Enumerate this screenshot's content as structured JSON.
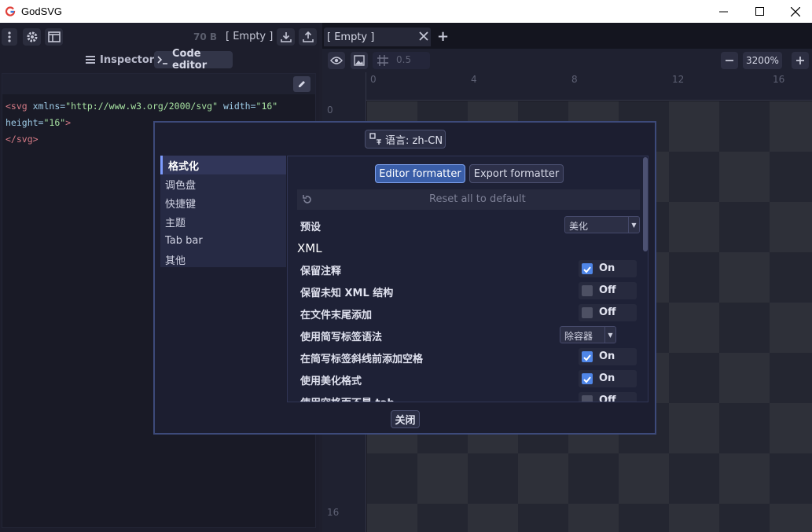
{
  "window": {
    "title": "GodSVG"
  },
  "left_panel": {
    "file_size": "70 B",
    "file_name": "[ Empty ]",
    "tabs": {
      "inspector": "Inspector",
      "code_editor": "Code editor"
    },
    "code_lines": [
      {
        "tag_open": "<svg",
        "attr1": " xmlns=",
        "str1": "\"http://www.w3.org/2000/svg\"",
        "attr2": " width=",
        "str2": "\"16\""
      },
      {
        "attr3": "height=",
        "str3": "\"16\"",
        "end": ">"
      },
      {
        "close": "</",
        "close_tag": "svg",
        "close_end": ">"
      }
    ]
  },
  "right_panel": {
    "tab_label": "[ Empty ]",
    "snap_value": "0.5",
    "zoom": "3200%",
    "ruler_top": [
      "0",
      "4",
      "8",
      "12",
      "16"
    ],
    "ruler_left": [
      "0",
      "16"
    ]
  },
  "dialog": {
    "language_button": "语言: zh-CN",
    "nav": [
      "格式化",
      "调色盘",
      "快捷键",
      "主题",
      "Tab bar",
      "其他"
    ],
    "segments": {
      "active": "Editor formatter",
      "inactive": "Export formatter"
    },
    "reset_label": "Reset all to default",
    "preset": {
      "label": "预设",
      "value": "美化"
    },
    "section": "XML",
    "settings": [
      {
        "label": "保留注释",
        "kind": "check",
        "state": "On"
      },
      {
        "label": "保留未知 XML 结构",
        "kind": "check",
        "state": "Off"
      },
      {
        "label": "在文件末尾添加",
        "kind": "check",
        "state": "Off"
      },
      {
        "label": "使用简写标签语法",
        "kind": "select",
        "value": "除容器"
      },
      {
        "label": "在简写标签斜线前添加空格",
        "kind": "check",
        "state": "On"
      },
      {
        "label": "使用美化格式",
        "kind": "check",
        "state": "On"
      },
      {
        "label": "使用空格而不是 tab",
        "kind": "check",
        "state": "Off"
      }
    ],
    "close_label": "关闭"
  }
}
